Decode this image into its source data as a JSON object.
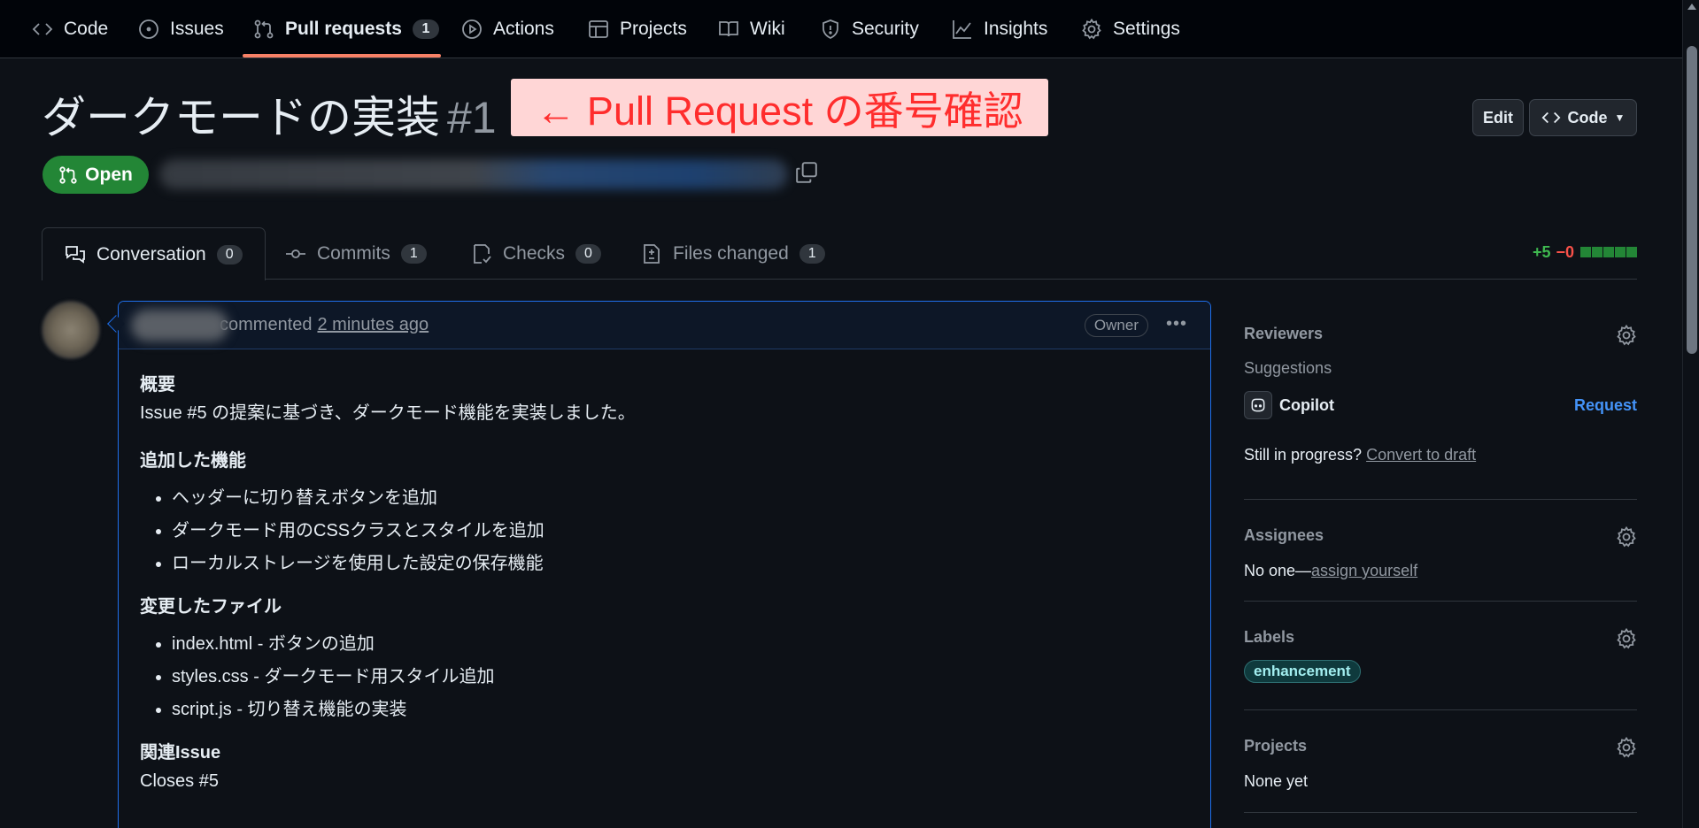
{
  "nav": {
    "items": [
      {
        "label": "Code",
        "icon": "code-icon"
      },
      {
        "label": "Issues",
        "icon": "issue-icon"
      },
      {
        "label": "Pull requests",
        "icon": "pull-request-icon",
        "count": "1",
        "active": true
      },
      {
        "label": "Actions",
        "icon": "play-icon"
      },
      {
        "label": "Projects",
        "icon": "table-icon"
      },
      {
        "label": "Wiki",
        "icon": "book-icon"
      },
      {
        "label": "Security",
        "icon": "shield-icon"
      },
      {
        "label": "Insights",
        "icon": "graph-icon"
      },
      {
        "label": "Settings",
        "icon": "gear-icon"
      }
    ]
  },
  "pr": {
    "title": "ダークモードの実装",
    "number": "#1",
    "state": "Open",
    "annotation": "← Pull Request の番号確認"
  },
  "header_buttons": {
    "edit": "Edit",
    "code": "Code"
  },
  "tabs": [
    {
      "label": "Conversation",
      "count": "0",
      "icon": "comment-discussion-icon"
    },
    {
      "label": "Commits",
      "count": "1",
      "icon": "commit-icon"
    },
    {
      "label": "Checks",
      "count": "0",
      "icon": "checklist-icon"
    },
    {
      "label": "Files changed",
      "count": "1",
      "icon": "file-diff-icon"
    }
  ],
  "diffstat": {
    "additions": "+5",
    "deletions": "−0"
  },
  "comment": {
    "action": "commented",
    "time": "2 minutes ago",
    "role": "Owner",
    "body": {
      "summary_heading": "概要",
      "summary_text": "Issue #5 の提案に基づき、ダークモード機能を実装しました。",
      "features_heading": "追加した機能",
      "features": [
        "ヘッダーに切り替えボタンを追加",
        "ダークモード用のCSSクラスとスタイルを追加",
        "ローカルストレージを使用した設定の保存機能"
      ],
      "files_heading": "変更したファイル",
      "files": [
        "index.html - ボタンの追加",
        "styles.css - ダークモード用スタイル追加",
        "script.js - 切り替え機能の実装"
      ],
      "related_heading": "関連Issue",
      "related_text": "Closes #5"
    }
  },
  "sidebar": {
    "reviewers": {
      "heading": "Reviewers",
      "suggestions": "Suggestions",
      "suggested_name": "Copilot",
      "request": "Request",
      "progress_text": "Still in progress?",
      "convert_link": "Convert to draft"
    },
    "assignees": {
      "heading": "Assignees",
      "none_text": "No one—",
      "assign_link": "assign yourself"
    },
    "labels": {
      "heading": "Labels",
      "items": [
        "enhancement"
      ]
    },
    "projects": {
      "heading": "Projects",
      "none_text": "None yet"
    }
  },
  "colors": {
    "background": "#0d1117",
    "accent_underline": "#f78166",
    "open_green": "#238636",
    "link_blue": "#4493f8",
    "annotation_red": "#ff2d2d"
  }
}
